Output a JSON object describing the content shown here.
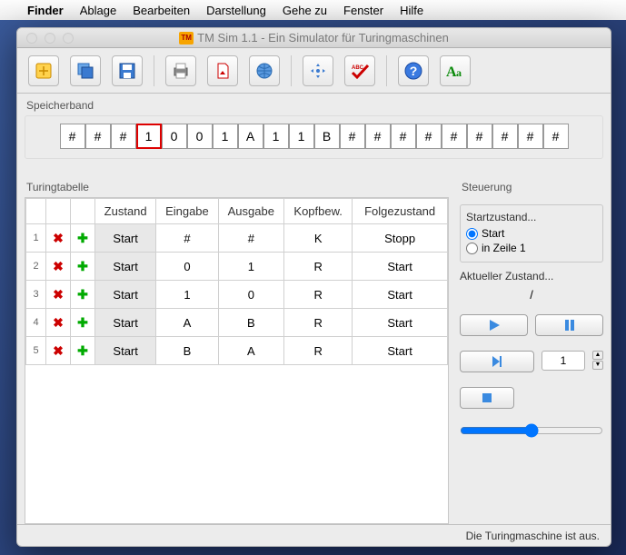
{
  "menubar": {
    "app": "Finder",
    "items": [
      "Ablage",
      "Bearbeiten",
      "Darstellung",
      "Gehe zu",
      "Fenster",
      "Hilfe"
    ]
  },
  "window": {
    "badge": "TM",
    "title": "TM Sim 1.1 - Ein Simulator für Turingmaschinen"
  },
  "sections": {
    "tape": "Speicherband",
    "table": "Turingtabelle",
    "control": "Steuerung"
  },
  "tape": {
    "head_index": 3,
    "cells": [
      "#",
      "#",
      "#",
      "1",
      "0",
      "0",
      "1",
      "A",
      "1",
      "1",
      "B",
      "#",
      "#",
      "#",
      "#",
      "#",
      "#",
      "#",
      "#",
      "#"
    ]
  },
  "table": {
    "headers": [
      "",
      "",
      "",
      "Zustand",
      "Eingabe",
      "Ausgabe",
      "Kopfbew.",
      "Folgezustand"
    ],
    "rows": [
      {
        "n": "1",
        "state": "Start",
        "in": "#",
        "out": "#",
        "move": "K",
        "next": "Stopp"
      },
      {
        "n": "2",
        "state": "Start",
        "in": "0",
        "out": "1",
        "move": "R",
        "next": "Start"
      },
      {
        "n": "3",
        "state": "Start",
        "in": "1",
        "out": "0",
        "move": "R",
        "next": "Start"
      },
      {
        "n": "4",
        "state": "Start",
        "in": "A",
        "out": "B",
        "move": "R",
        "next": "Start"
      },
      {
        "n": "5",
        "state": "Start",
        "in": "B",
        "out": "A",
        "move": "R",
        "next": "Start"
      }
    ]
  },
  "control": {
    "startstate_label": "Startzustand...",
    "radio1": "Start",
    "radio2": "in Zeile 1",
    "current_label": "Aktueller Zustand...",
    "current_value": "/",
    "step_value": "1"
  },
  "status": "Die Turingmaschine ist aus."
}
